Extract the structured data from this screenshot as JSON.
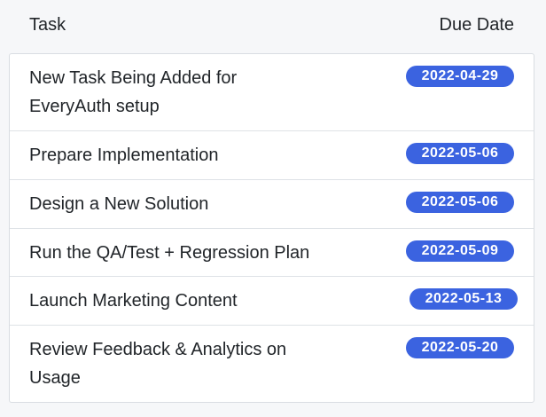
{
  "header": {
    "task_label": "Task",
    "due_label": "Due Date"
  },
  "tasks": [
    {
      "title": "New Task Being Added for EveryAuth setup",
      "due": "2022-04-29"
    },
    {
      "title": "Prepare Implementation",
      "due": "2022-05-06"
    },
    {
      "title": "Design a New Solution",
      "due": "2022-05-06"
    },
    {
      "title": "Run the QA/Test + Regression Plan",
      "due": "2022-05-09"
    },
    {
      "title": "Launch Marketing Content",
      "due": "2022-05-13"
    },
    {
      "title": "Review Feedback & Analytics on Usage",
      "due": "2022-05-20"
    }
  ],
  "colors": {
    "badge_bg": "#3b63e0",
    "badge_text": "#ffffff",
    "page_bg": "#f6f7f9"
  }
}
